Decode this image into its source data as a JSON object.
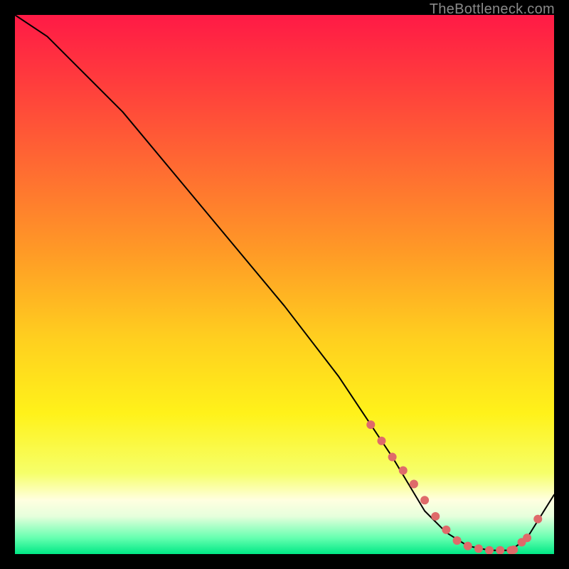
{
  "watermark": "TheBottleneck.com",
  "colors": {
    "black": "#000000",
    "marker": "#df6a6a",
    "curve": "#000000",
    "gradient_stops": [
      {
        "offset": 0.0,
        "color": "#ff1a46"
      },
      {
        "offset": 0.12,
        "color": "#ff3b3d"
      },
      {
        "offset": 0.28,
        "color": "#ff6a32"
      },
      {
        "offset": 0.44,
        "color": "#ff9a26"
      },
      {
        "offset": 0.6,
        "color": "#ffcf1f"
      },
      {
        "offset": 0.74,
        "color": "#fff21a"
      },
      {
        "offset": 0.85,
        "color": "#f6ff6a"
      },
      {
        "offset": 0.9,
        "color": "#ffffe0"
      },
      {
        "offset": 0.93,
        "color": "#e6ffdc"
      },
      {
        "offset": 0.97,
        "color": "#66ffb0"
      },
      {
        "offset": 1.0,
        "color": "#00e885"
      }
    ]
  },
  "chart_data": {
    "type": "line",
    "title": "",
    "xlabel": "",
    "ylabel": "",
    "xlim": [
      0,
      100
    ],
    "ylim": [
      0,
      100
    ],
    "grid": false,
    "series": [
      {
        "name": "curve",
        "x": [
          0,
          6,
          12,
          20,
          30,
          40,
          50,
          60,
          66,
          70,
          73,
          76,
          80,
          84,
          88,
          92,
          95,
          100
        ],
        "y": [
          100,
          96,
          90,
          82,
          70,
          58,
          46,
          33,
          24,
          18,
          13,
          8,
          4,
          1.5,
          0.7,
          0.7,
          3,
          11
        ]
      }
    ],
    "markers": {
      "name": "highlighted-points",
      "x": [
        66,
        68,
        70,
        72,
        74,
        76,
        78,
        80,
        82,
        84,
        86,
        88,
        90,
        92,
        92.5,
        94,
        95,
        97
      ],
      "y": [
        24,
        21,
        18,
        15.5,
        13,
        10,
        7,
        4.5,
        2.5,
        1.5,
        1,
        0.7,
        0.7,
        0.7,
        0.8,
        2.2,
        3,
        6.5
      ]
    }
  }
}
